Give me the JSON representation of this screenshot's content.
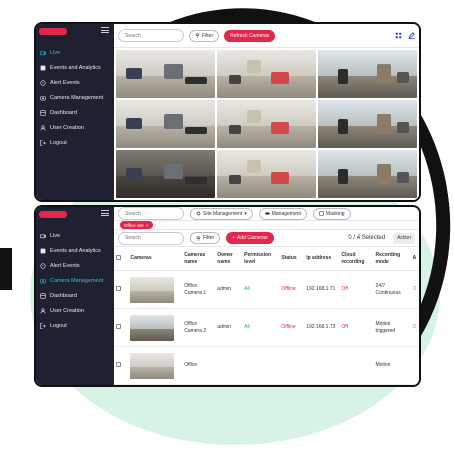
{
  "live_view": {
    "search_placeholder": "Search",
    "filter_label": "Filter",
    "refresh_label": "Refresh Cameras",
    "feeds": [
      {
        "scene": "office"
      },
      {
        "scene": "office"
      },
      {
        "scene": "street"
      },
      {
        "scene": "office"
      },
      {
        "scene": "office"
      },
      {
        "scene": "street"
      },
      {
        "scene": "dark"
      },
      {
        "scene": "office"
      },
      {
        "scene": "street"
      }
    ]
  },
  "sidebar_top": {
    "items": [
      {
        "label": "Live",
        "icon": "live-icon",
        "active": true
      },
      {
        "label": "Events and Analytics",
        "icon": "events-icon",
        "active": false
      },
      {
        "label": "Alert Events",
        "icon": "alert-icon",
        "active": false
      },
      {
        "label": "Camera Management",
        "icon": "camera-icon",
        "active": false
      },
      {
        "label": "Dashboard",
        "icon": "dashboard-icon",
        "active": false
      },
      {
        "label": "User Creation",
        "icon": "user-icon",
        "active": false
      },
      {
        "label": "Logout",
        "icon": "logout-icon",
        "active": false
      }
    ]
  },
  "sidebar_bottom": {
    "items": [
      {
        "label": "Live",
        "icon": "live-icon",
        "active": false
      },
      {
        "label": "Events and Analytics",
        "icon": "events-icon",
        "active": false
      },
      {
        "label": "Alert Events",
        "icon": "alert-icon",
        "active": false
      },
      {
        "label": "Camera Management",
        "icon": "camera-icon",
        "active": true
      },
      {
        "label": "Dashboard",
        "icon": "dashboard-icon",
        "active": false
      },
      {
        "label": "User Creation",
        "icon": "user-icon",
        "active": false
      },
      {
        "label": "Logout",
        "icon": "logout-icon",
        "active": false
      }
    ]
  },
  "camera_management": {
    "top_search_placeholder": "Search",
    "site_management_label": "Site Management",
    "management_label": "Management",
    "masking_label": "Masking",
    "chip_label": "Office site",
    "search_placeholder": "Search",
    "filter_label": "Filter",
    "add_cameras_label": "Add Cameras",
    "selected_text": "0 / 4 Selected",
    "action_label": "Action",
    "columns": [
      "Cameras",
      "Cameras name",
      "Owner name",
      "Permission level",
      "Status",
      "Ip address",
      "Cloud recording",
      "Recording mode",
      "A"
    ],
    "rows": [
      {
        "name": "Office Camera 1",
        "owner": "admin",
        "permission": "All",
        "status": "Offline",
        "ip": "192.168.1.71",
        "cloud": "Off",
        "mode": "24/7 Continuous",
        "extra": "O"
      },
      {
        "name": "Office Camera 2",
        "owner": "admin",
        "permission": "All",
        "status": "Offline",
        "ip": "192.168.1.73",
        "cloud": "Off",
        "mode": "Motion triggered",
        "extra": "O"
      },
      {
        "name": "Office",
        "owner": "",
        "permission": "",
        "status": "",
        "ip": "",
        "cloud": "",
        "mode": "Motion",
        "extra": ""
      }
    ]
  },
  "colors": {
    "accent": "#e2284a",
    "active_nav": "#25c3ea",
    "sidebar": "#1f2030",
    "online_green": "#2bb24c"
  }
}
